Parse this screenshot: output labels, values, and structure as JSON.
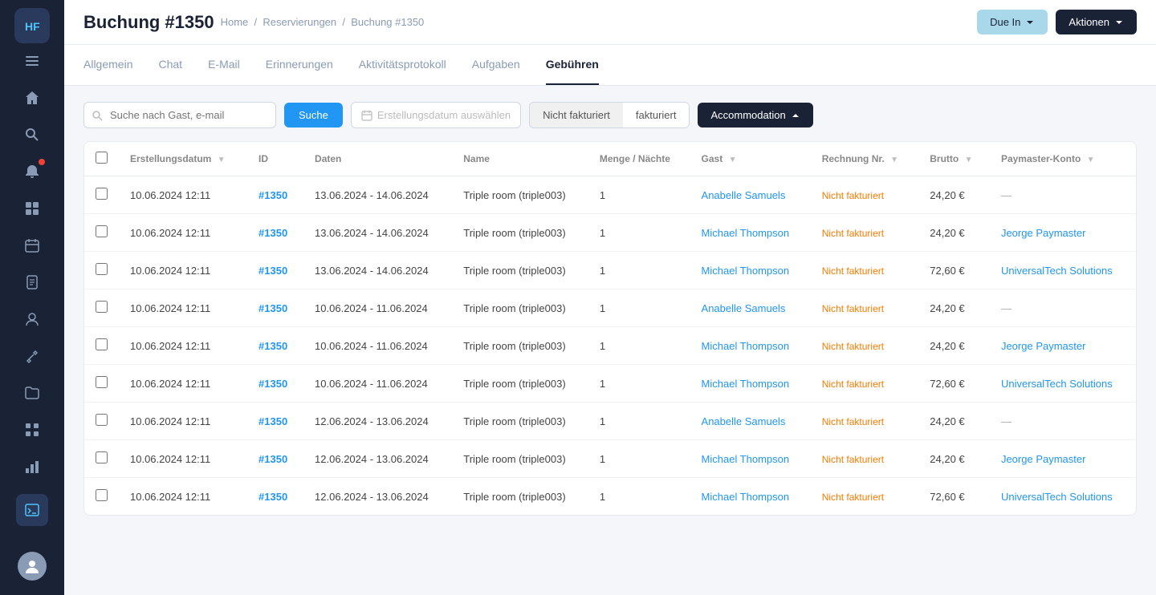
{
  "header": {
    "title": "Buchung #1350",
    "breadcrumb": [
      "Home",
      "Reservierungen",
      "Buchung #1350"
    ],
    "due_in_label": "Due In",
    "aktionen_label": "Aktionen"
  },
  "tabs": [
    {
      "label": "Allgemein",
      "active": false
    },
    {
      "label": "Chat",
      "active": false
    },
    {
      "label": "E-Mail",
      "active": false
    },
    {
      "label": "Erinnerungen",
      "active": false
    },
    {
      "label": "Aktivitätsprotokoll",
      "active": false
    },
    {
      "label": "Aufgaben",
      "active": false
    },
    {
      "label": "Gebühren",
      "active": true
    }
  ],
  "filters": {
    "search_placeholder": "Suche nach Gast, e-mail",
    "search_button": "Suche",
    "date_placeholder": "Erstellungsdatum auswählen",
    "toggle": {
      "option1": "Nicht fakturiert",
      "option2": "fakturiert"
    },
    "accommodation_label": "Accommodation"
  },
  "table": {
    "columns": [
      "Erstellungsdatum",
      "ID",
      "Daten",
      "Name",
      "Menge / Nächte",
      "Gast",
      "Rechnung Nr.",
      "Brutto",
      "Paymaster-Konto"
    ],
    "rows": [
      {
        "creation_date": "10.06.2024 12:11",
        "id": "#1350",
        "dates": "13.06.2024 - 14.06.2024",
        "name": "Triple room (triple003)",
        "quantity": "1",
        "guest": "Anabelle Samuels",
        "invoice": "Nicht fakturiert",
        "invoice_status": "not",
        "brutto": "24,20 €",
        "paymaster": "—",
        "paymaster_type": "dash"
      },
      {
        "creation_date": "10.06.2024 12:11",
        "id": "#1350",
        "dates": "13.06.2024 - 14.06.2024",
        "name": "Triple room (triple003)",
        "quantity": "1",
        "guest": "Michael Thompson",
        "invoice": "Nicht fakturiert",
        "invoice_status": "not",
        "brutto": "24,20 €",
        "paymaster": "Jeorge Paymaster",
        "paymaster_type": "link"
      },
      {
        "creation_date": "10.06.2024 12:11",
        "id": "#1350",
        "dates": "13.06.2024 - 14.06.2024",
        "name": "Triple room (triple003)",
        "quantity": "1",
        "guest": "Michael Thompson",
        "invoice": "Nicht fakturiert",
        "invoice_status": "not",
        "brutto": "72,60 €",
        "paymaster": "UniversalTech Solutions",
        "paymaster_type": "link"
      },
      {
        "creation_date": "10.06.2024 12:11",
        "id": "#1350",
        "dates": "10.06.2024 - 11.06.2024",
        "name": "Triple room (triple003)",
        "quantity": "1",
        "guest": "Anabelle Samuels",
        "invoice": "Nicht fakturiert",
        "invoice_status": "not",
        "brutto": "24,20 €",
        "paymaster": "—",
        "paymaster_type": "dash"
      },
      {
        "creation_date": "10.06.2024 12:11",
        "id": "#1350",
        "dates": "10.06.2024 - 11.06.2024",
        "name": "Triple room (triple003)",
        "quantity": "1",
        "guest": "Michael Thompson",
        "invoice": "Nicht fakturiert",
        "invoice_status": "not",
        "brutto": "24,20 €",
        "paymaster": "Jeorge Paymaster",
        "paymaster_type": "link"
      },
      {
        "creation_date": "10.06.2024 12:11",
        "id": "#1350",
        "dates": "10.06.2024 - 11.06.2024",
        "name": "Triple room (triple003)",
        "quantity": "1",
        "guest": "Michael Thompson",
        "invoice": "Nicht fakturiert",
        "invoice_status": "not",
        "brutto": "72,60 €",
        "paymaster": "UniversalTech Solutions",
        "paymaster_type": "link"
      },
      {
        "creation_date": "10.06.2024 12:11",
        "id": "#1350",
        "dates": "12.06.2024 - 13.06.2024",
        "name": "Triple room (triple003)",
        "quantity": "1",
        "guest": "Anabelle Samuels",
        "invoice": "Nicht fakturiert",
        "invoice_status": "not",
        "brutto": "24,20 €",
        "paymaster": "—",
        "paymaster_type": "dash"
      },
      {
        "creation_date": "10.06.2024 12:11",
        "id": "#1350",
        "dates": "12.06.2024 - 13.06.2024",
        "name": "Triple room (triple003)",
        "quantity": "1",
        "guest": "Michael Thompson",
        "invoice": "Nicht fakturiert",
        "invoice_status": "not",
        "brutto": "24,20 €",
        "paymaster": "Jeorge Paymaster",
        "paymaster_type": "link"
      },
      {
        "creation_date": "10.06.2024 12:11",
        "id": "#1350",
        "dates": "12.06.2024 - 13.06.2024",
        "name": "Triple room (triple003)",
        "quantity": "1",
        "guest": "Michael Thompson",
        "invoice": "Nicht fakturiert",
        "invoice_status": "not",
        "brutto": "72,60 €",
        "paymaster": "UniversalTech Solutions",
        "paymaster_type": "link"
      }
    ]
  },
  "sidebar": {
    "icons": [
      {
        "name": "home-icon",
        "symbol": "⌂",
        "active": false
      },
      {
        "name": "search-icon",
        "symbol": "🔍",
        "active": false
      },
      {
        "name": "bell-icon",
        "symbol": "🔔",
        "active": false,
        "badge": true
      },
      {
        "name": "grid-icon",
        "symbol": "⊞",
        "active": false
      },
      {
        "name": "calendar-icon",
        "symbol": "📅",
        "active": false
      },
      {
        "name": "document-icon",
        "symbol": "📄",
        "active": false
      },
      {
        "name": "user-icon",
        "symbol": "👤",
        "active": false
      },
      {
        "name": "tools-icon",
        "symbol": "🔧",
        "active": false
      },
      {
        "name": "folder-icon",
        "symbol": "📁",
        "active": false
      },
      {
        "name": "modules-icon",
        "symbol": "⊞",
        "active": false
      },
      {
        "name": "chart-icon",
        "symbol": "📊",
        "active": false
      },
      {
        "name": "terminal-icon",
        "symbol": "⬛",
        "active": true
      }
    ]
  }
}
